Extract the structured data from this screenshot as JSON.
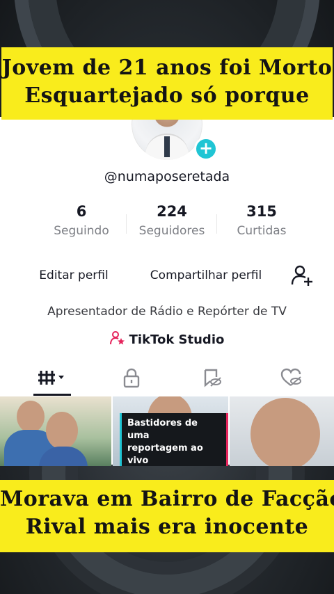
{
  "overlay": {
    "top_line1": "Jovem de 21 anos foi Morto",
    "top_line2": "Esquartejado só porque",
    "bottom_line1": "Morava em Bairro de Facção",
    "bottom_line2": "Rival mais era inocente",
    "banner_color": "#f9ec1c"
  },
  "profile": {
    "username": "@numaposeretada",
    "add_icon": "plus-icon",
    "stats": [
      {
        "value": "6",
        "label": "Seguindo"
      },
      {
        "value": "224",
        "label": "Seguidores"
      },
      {
        "value": "315",
        "label": "Curtidas"
      }
    ],
    "edit_button": "Editar perfil",
    "share_button": "Compartilhar perfil",
    "add_friend_icon": "add-user-icon",
    "bio": "Apresentador de Rádio e Repórter de TV",
    "studio_link": "TikTok Studio",
    "accent_color": "#20c5d4"
  },
  "tabs": [
    {
      "icon": "grid-icon"
    },
    {
      "icon": "lock-icon"
    },
    {
      "icon": "repost-hidden-icon"
    },
    {
      "icon": "liked-hidden-icon"
    }
  ],
  "videos": [
    {
      "caption": ""
    },
    {
      "caption_line1": "Bastidores de uma",
      "caption_line2": "reportagem ao vivo"
    },
    {
      "caption": ""
    }
  ]
}
